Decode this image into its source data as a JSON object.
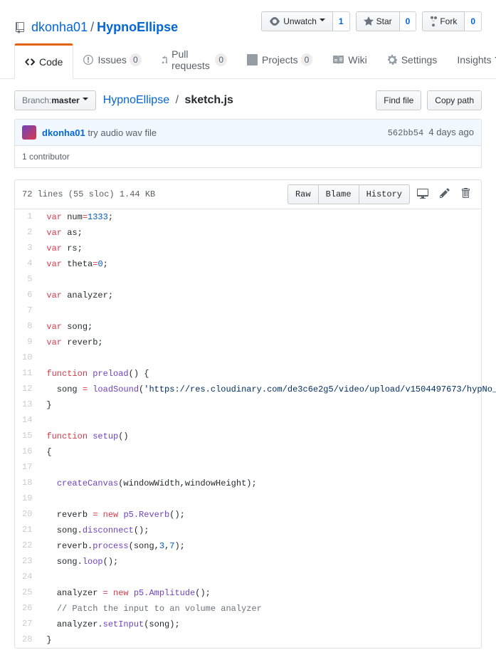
{
  "repo": {
    "owner": "dkonha01",
    "name": "HypnoEllipse"
  },
  "actions": {
    "unwatch": {
      "label": "Unwatch",
      "count": "1"
    },
    "star": {
      "label": "Star",
      "count": "0"
    },
    "fork": {
      "label": "Fork",
      "count": "0"
    }
  },
  "nav": {
    "code": "Code",
    "issues": {
      "label": "Issues",
      "count": "0"
    },
    "pulls": {
      "label": "Pull requests",
      "count": "0"
    },
    "projects": {
      "label": "Projects",
      "count": "0"
    },
    "wiki": "Wiki",
    "settings": "Settings",
    "insights": "Insights"
  },
  "branch": {
    "prefix": "Branch:",
    "name": "master"
  },
  "breadcrumb": {
    "root": "HypnoEllipse",
    "file": "sketch.js"
  },
  "filenav": {
    "find": "Find file",
    "copy": "Copy path"
  },
  "commit": {
    "author": "dkonha01",
    "message": "try audio wav file",
    "sha": "562bb54",
    "age": "4 days ago"
  },
  "contrib": "1 contributor",
  "fileinfo": "72 lines (55 sloc)  1.44 KB",
  "blob": {
    "raw": "Raw",
    "blame": "Blame",
    "history": "History"
  },
  "code": [
    {
      "n": 1,
      "h": "<span class='kw'>var</span> num<span class='op'>=</span><span class='num'>1333</span>;"
    },
    {
      "n": 2,
      "h": "<span class='kw'>var</span> as;"
    },
    {
      "n": 3,
      "h": "<span class='kw'>var</span> rs;"
    },
    {
      "n": 4,
      "h": "<span class='kw'>var</span> theta<span class='op'>=</span><span class='num'>0</span>;"
    },
    {
      "n": 5,
      "h": ""
    },
    {
      "n": 6,
      "h": "<span class='kw'>var</span> analyzer;"
    },
    {
      "n": 7,
      "h": ""
    },
    {
      "n": 8,
      "h": "<span class='kw'>var</span> song;"
    },
    {
      "n": 9,
      "h": "<span class='kw'>var</span> reverb;"
    },
    {
      "n": 10,
      "h": ""
    },
    {
      "n": 11,
      "h": "<span class='kw'>function</span> <span class='fn'>preload</span>() {"
    },
    {
      "n": 12,
      "h": "  song <span class='op'>=</span> <span class='fn'>loadSound</span>(<span class='str'>'https://res.cloudinary.com/de3c6e2g5/video/upload/v1504497673/hypNo_qpbdwj.wav'</span>);"
    },
    {
      "n": 13,
      "h": "}"
    },
    {
      "n": 14,
      "h": ""
    },
    {
      "n": 15,
      "h": "<span class='kw'>function</span> <span class='fn'>setup</span>()"
    },
    {
      "n": 16,
      "h": "{"
    },
    {
      "n": 17,
      "h": ""
    },
    {
      "n": 18,
      "h": "  <span class='fn'>createCanvas</span>(windowWidth,windowHeight);"
    },
    {
      "n": 19,
      "h": ""
    },
    {
      "n": 20,
      "h": "  reverb <span class='op'>=</span> <span class='kw'>new</span> <span class='fn'>p5.Reverb</span>();"
    },
    {
      "n": 21,
      "h": "  song.<span class='fn'>disconnect</span>();"
    },
    {
      "n": 22,
      "h": "  reverb.<span class='fn'>process</span>(song,<span class='num'>3</span>,<span class='num'>7</span>);"
    },
    {
      "n": 23,
      "h": "  song.<span class='fn'>loop</span>();"
    },
    {
      "n": 24,
      "h": ""
    },
    {
      "n": 25,
      "h": "  analyzer <span class='op'>=</span> <span class='kw'>new</span> <span class='fn'>p5.Amplitude</span>();"
    },
    {
      "n": 26,
      "h": "  <span class='cm'>// Patch the input to an volume analyzer</span>"
    },
    {
      "n": 27,
      "h": "  analyzer.<span class='fn'>setInput</span>(song);"
    },
    {
      "n": 28,
      "h": "}"
    }
  ]
}
